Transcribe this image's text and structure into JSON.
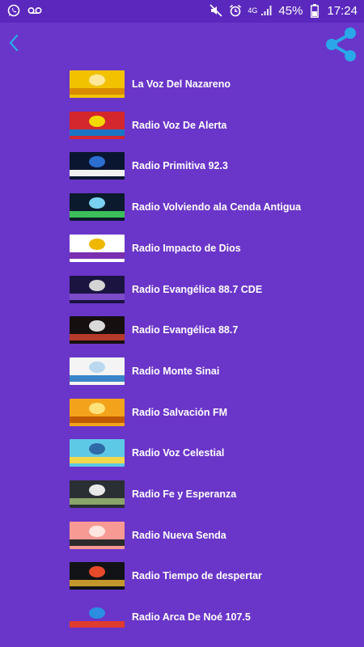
{
  "status_bar": {
    "battery": "45%",
    "time": "17:24",
    "network": "4G"
  },
  "colors": {
    "background": "#6a35c9",
    "status_bar": "#5b28bd",
    "accent_blue": "#2aa7e8",
    "text": "#ffffff"
  },
  "stations": [
    {
      "name": "La Voz Del Nazareno",
      "logo_colors": [
        "#f2c200",
        "#d98a00",
        "#ffe89a"
      ]
    },
    {
      "name": "Radio Voz De Alerta",
      "logo_colors": [
        "#d3262d",
        "#1a76c4",
        "#f5d800"
      ]
    },
    {
      "name": "Radio Primitiva 92.3",
      "logo_colors": [
        "#0a1630",
        "#f1f1f1",
        "#2d6fd0"
      ]
    },
    {
      "name": "Radio Volviendo ala Cenda Antigua",
      "logo_colors": [
        "#0b1a2c",
        "#3cbf5a",
        "#7ad0f0"
      ]
    },
    {
      "name": "Radio Impacto de Dios",
      "logo_colors": [
        "#ffffff",
        "#7a2fb0",
        "#f0b800"
      ]
    },
    {
      "name": "Radio Evangélica 88.7 CDE",
      "logo_colors": [
        "#1b1440",
        "#7d4cc9",
        "#d4d4d4"
      ]
    },
    {
      "name": "Radio Evangélica 88.7",
      "logo_colors": [
        "#160f10",
        "#b53a2a",
        "#d9d9d9"
      ]
    },
    {
      "name": "Radio Monte Sinai",
      "logo_colors": [
        "#f4f4f4",
        "#3a84c9",
        "#b9d8ef"
      ]
    },
    {
      "name": "Radio Salvación FM",
      "logo_colors": [
        "#f3a31b",
        "#c05a00",
        "#ffe27a"
      ]
    },
    {
      "name": "Radio Voz Celestial",
      "logo_colors": [
        "#5ec9e6",
        "#f2d74a",
        "#2f6aa8"
      ]
    },
    {
      "name": "Radio Fe y Esperanza",
      "logo_colors": [
        "#2a2f34",
        "#8aa46a",
        "#e9e9e9"
      ]
    },
    {
      "name": "Radio Nueva Senda",
      "logo_colors": [
        "#f79a93",
        "#2b2b2b",
        "#ffe6e2"
      ]
    },
    {
      "name": "Radio Tiempo de despertar",
      "logo_colors": [
        "#111316",
        "#c4972c",
        "#e84a2a"
      ]
    },
    {
      "name": "Radio Arca De Noé 107.5",
      "logo_colors": [
        "#6a35c9",
        "#e03b2f",
        "#2c8ee0"
      ]
    }
  ]
}
